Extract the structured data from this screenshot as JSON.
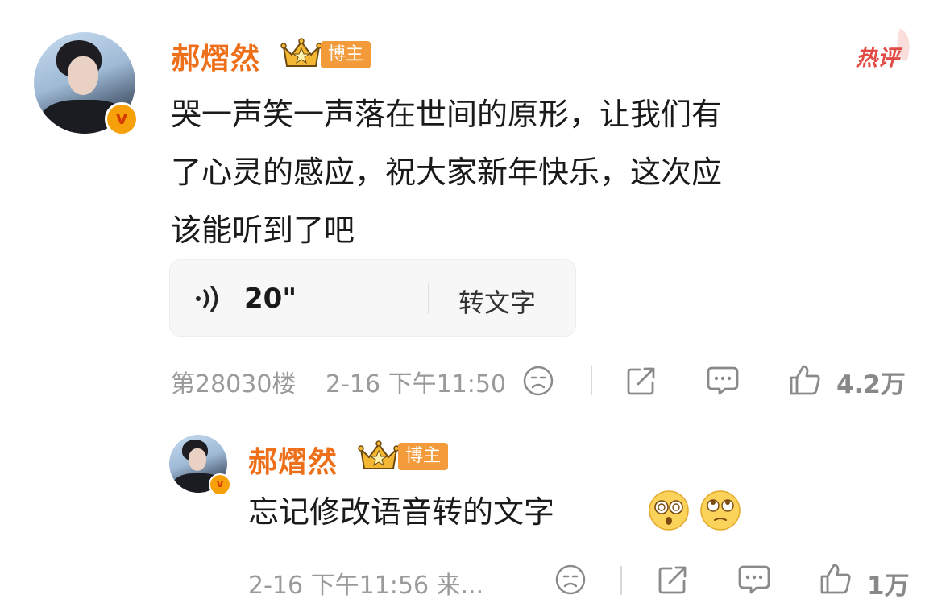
{
  "comment": {
    "author": "郝熠然",
    "role_badge": "博主",
    "hot_label": "热评",
    "text_lines": [
      "哭一声笑一声落在世间的原形，让我们有",
      "了心灵的感应，祝大家新年快乐，这次应",
      "该能听到了吧"
    ],
    "voice": {
      "duration": "20\"",
      "convert_label": "转文字"
    },
    "floor": "第28030楼",
    "datetime": "2-16 下午11:50",
    "likes": "4.2万"
  },
  "reply": {
    "author": "郝熠然",
    "role_badge": "博主",
    "text": "忘记修改语音转的文字",
    "emojis": [
      "dizzy-eyes-emoji",
      "rolling-eyes-emoji"
    ],
    "datetime": "2-16 下午11:56 来...",
    "likes": "1万"
  },
  "colors": {
    "name": "#ee6f1a",
    "hot": "#e24a45",
    "badge": "#f39a3a",
    "meta": "#9a9a9a",
    "verified": "#f7a10a"
  }
}
